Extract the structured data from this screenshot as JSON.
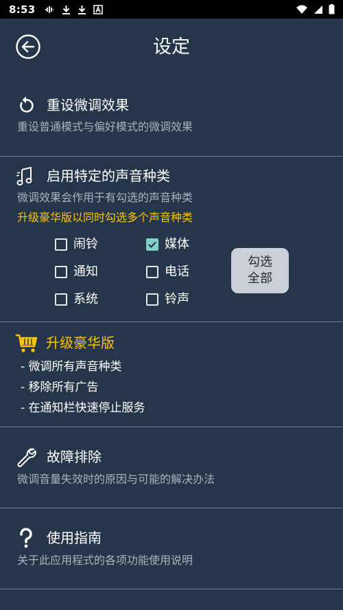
{
  "status_bar": {
    "time": "8:53",
    "left_icons": [
      "voicemail-icon",
      "download-icon",
      "download-icon",
      "a-badge-icon"
    ],
    "right_icons": [
      "wifi-icon",
      "signal-icon",
      "battery-icon"
    ]
  },
  "app_bar": {
    "title": "设定",
    "back_icon": "back-circle-icon"
  },
  "reset": {
    "icon": "reset-icon",
    "title": "重设微调效果",
    "subtitle": "重设普通模式与偏好模式的微调效果"
  },
  "sound_types": {
    "icon": "music-notes-icon",
    "title": "启用特定的声音种类",
    "subtitle": "微调效果会作用于有勾选的声音种类",
    "promo": "升级豪华版以同时勾选多个声音种类",
    "checkboxes": [
      {
        "label": "闹铃",
        "checked": false
      },
      {
        "label": "媒体",
        "checked": true
      },
      {
        "label": "通知",
        "checked": false
      },
      {
        "label": "电话",
        "checked": false
      },
      {
        "label": "系统",
        "checked": false
      },
      {
        "label": "铃声",
        "checked": false
      }
    ],
    "select_all_line1": "勾选",
    "select_all_line2": "全部"
  },
  "upgrade": {
    "icon": "shopping-cart-icon",
    "title": "升级豪华版",
    "bullets": [
      "- 微调所有声音种类",
      "- 移除所有广告",
      "- 在通知栏快速停止服务"
    ]
  },
  "troubleshoot": {
    "icon": "wrench-icon",
    "title": "故障排除",
    "subtitle": "微调音量失效时的原因与可能的解决办法"
  },
  "guide": {
    "icon": "question-icon",
    "title": "使用指南",
    "subtitle": "关于此应用程式的各项功能使用说明"
  },
  "colors": {
    "background": "#26364a",
    "accent_yellow": "#ffc400",
    "checkbox_checked": "#7fd1c8",
    "subtitle_gray": "#a9b2be"
  }
}
